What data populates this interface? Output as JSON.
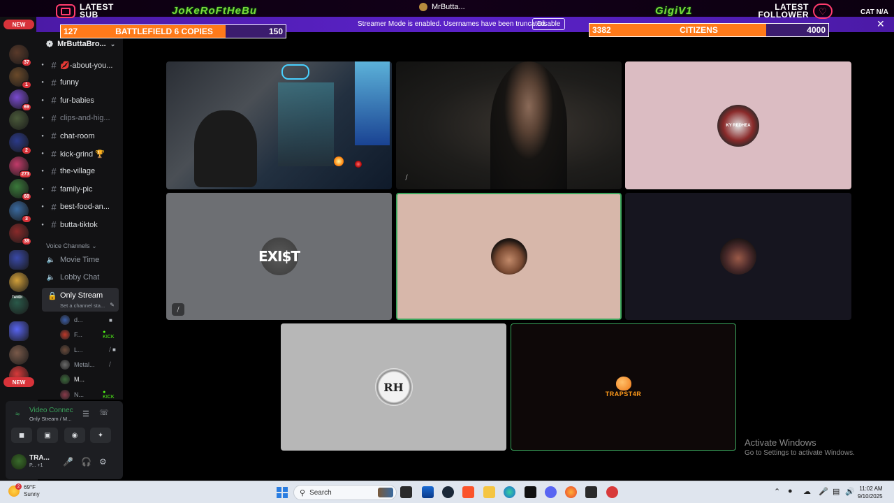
{
  "overlay": {
    "latest_sub_label": "LATEST SUB",
    "latest_sub_name": "JoKeRoFtHeBu",
    "center_name": "MrButta...",
    "latest_follower_name": "GigiV1",
    "latest_follower_label": "LATEST FOLLOWER",
    "edge_text": "CAT N/A",
    "streamer_mode_text": "Streamer Mode is enabled. Usernames have been truncated.",
    "disable_label": "Disable",
    "goal_left": {
      "current": "127",
      "title": "BATTLEFIELD 6 COPIES",
      "target": "150",
      "progress": 0.847
    },
    "goal_right": {
      "current": "3382",
      "title": "CITIZENS",
      "target": "4000",
      "progress": 0.8455
    }
  },
  "rail": {
    "new_label": "NEW",
    "servers": [
      {
        "badge": "37",
        "color": "#5a3a2a"
      },
      {
        "badge": "1",
        "color": "#6b4a2a"
      },
      {
        "badge": "69",
        "color": "#7a4ad0"
      },
      {
        "badge": "",
        "color": "#4a5a3a"
      },
      {
        "badge": "2",
        "color": "#2b3a8a"
      },
      {
        "badge": "273",
        "color": "#c23b6a"
      },
      {
        "badge": "68",
        "color": "#3a7a3a"
      },
      {
        "badge": "3",
        "color": "#3a6aa0"
      },
      {
        "badge": "38",
        "color": "#8a2a2a"
      },
      {
        "badge": "",
        "color": "#3a4aaa"
      },
      {
        "badge": "",
        "color": "#d2a03a"
      },
      {
        "badge": "",
        "color": "#2a5a4a"
      },
      {
        "badge": "",
        "color": "#5865f2"
      },
      {
        "badge": "",
        "color": "#7a5a4a"
      },
      {
        "badge": "",
        "color": "#d83a3a"
      }
    ],
    "tandi_label": "TANDI",
    "new_label_bottom": "NEW"
  },
  "channels": {
    "server_name": "MrButtaBro...",
    "text": [
      {
        "name": "💋-about-you...",
        "muted": false
      },
      {
        "name": "funny",
        "muted": false
      },
      {
        "name": "fur-babies",
        "muted": false
      },
      {
        "name": "clips-and-hig...",
        "muted": true
      },
      {
        "name": "chat-room",
        "muted": false
      },
      {
        "name": "kick-grind 🏆",
        "muted": false
      },
      {
        "name": "the-village",
        "muted": false
      },
      {
        "name": "family-pic",
        "muted": false
      },
      {
        "name": "best-food-an...",
        "muted": false
      },
      {
        "name": "butta-tiktok",
        "muted": false
      }
    ],
    "voice_header": "Voice Channels",
    "voice": [
      {
        "name": "Movie Time"
      },
      {
        "name": "Lobby Chat"
      }
    ],
    "active_voice": {
      "name": "Only Stream",
      "status": "Set a channel sta..."
    },
    "voice_users": [
      {
        "name": "d...",
        "status": "■",
        "kick": "",
        "color": "#3b5ea8"
      },
      {
        "name": "F...",
        "status": "",
        "kick": "● KICK",
        "color": "#c0392b"
      },
      {
        "name": "L...",
        "status": "⧸ ■",
        "kick": "",
        "color": "#6a4a3a"
      },
      {
        "name": "Metal...",
        "status": "⧸",
        "kick": "",
        "color": "#6b6b6b"
      },
      {
        "name": "M...",
        "status": "",
        "kick": "",
        "color": "#3a6a3a"
      },
      {
        "name": "N...",
        "status": "",
        "kick": "● KICK",
        "color": "#8a3a4a"
      }
    ]
  },
  "user_panel": {
    "connection": "Video Connec",
    "connection_sub": "Only Stream / M...",
    "username": "TRA...",
    "user_sub": "P... +1"
  },
  "tiles": {
    "exist_text": "EXI$T",
    "rh_text": "RH",
    "trap_text": "TRAPST4R",
    "redhead_text": "KY REDHEA"
  },
  "watermark": {
    "title": "Activate Windows",
    "sub": "Go to Settings to activate Windows."
  },
  "taskbar": {
    "temp": "69°F",
    "condition": "Sunny",
    "weather_badge": "2",
    "search_placeholder": "Search",
    "time": "11:02 AM",
    "date": "9/10/2025"
  }
}
